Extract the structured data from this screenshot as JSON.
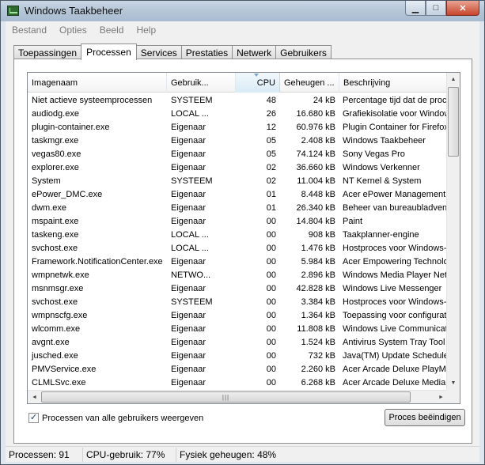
{
  "window": {
    "title": "Windows Taakbeheer"
  },
  "controls": {
    "minimize": "▁",
    "maximize": "□",
    "close": "✕"
  },
  "menu": [
    "Bestand",
    "Opties",
    "Beeld",
    "Help"
  ],
  "tabs": [
    {
      "label": "Toepassingen",
      "active": false
    },
    {
      "label": "Processen",
      "active": true
    },
    {
      "label": "Services",
      "active": false
    },
    {
      "label": "Prestaties",
      "active": false
    },
    {
      "label": "Netwerk",
      "active": false
    },
    {
      "label": "Gebruikers",
      "active": false
    }
  ],
  "columns": {
    "name": "Imagenaam",
    "user": "Gebruik...",
    "cpu": "CPU",
    "memory": "Geheugen ...",
    "description": "Beschrijving"
  },
  "rows": [
    {
      "name": "Niet actieve systeemprocessen",
      "user": "SYSTEEM",
      "cpu": "48",
      "mem": "24 kB",
      "desc": "Percentage tijd dat de processor niet actief is"
    },
    {
      "name": "audiodg.exe",
      "user": "LOCAL ...",
      "cpu": "26",
      "mem": "16.680 kB",
      "desc": "Grafiekisolatie voor Windows-audioapparaat"
    },
    {
      "name": "plugin-container.exe",
      "user": "Eigenaar",
      "cpu": "12",
      "mem": "60.976 kB",
      "desc": "Plugin Container for Firefox"
    },
    {
      "name": "taskmgr.exe",
      "user": "Eigenaar",
      "cpu": "05",
      "mem": "2.408 kB",
      "desc": "Windows Taakbeheer"
    },
    {
      "name": "vegas80.exe",
      "user": "Eigenaar",
      "cpu": "05",
      "mem": "74.124 kB",
      "desc": "Sony Vegas Pro"
    },
    {
      "name": "explorer.exe",
      "user": "Eigenaar",
      "cpu": "02",
      "mem": "36.660 kB",
      "desc": "Windows Verkenner"
    },
    {
      "name": "System",
      "user": "SYSTEEM",
      "cpu": "02",
      "mem": "11.004 kB",
      "desc": "NT Kernel & System"
    },
    {
      "name": "ePower_DMC.exe",
      "user": "Eigenaar",
      "cpu": "01",
      "mem": "8.448 kB",
      "desc": "Acer ePower Management - DMC"
    },
    {
      "name": "dwm.exe",
      "user": "Eigenaar",
      "cpu": "01",
      "mem": "26.340 kB",
      "desc": "Beheer van bureaubladvensters"
    },
    {
      "name": "mspaint.exe",
      "user": "Eigenaar",
      "cpu": "00",
      "mem": "14.804 kB",
      "desc": "Paint"
    },
    {
      "name": "taskeng.exe",
      "user": "LOCAL ...",
      "cpu": "00",
      "mem": "908 kB",
      "desc": "Taakplanner-engine"
    },
    {
      "name": "svchost.exe",
      "user": "LOCAL ...",
      "cpu": "00",
      "mem": "1.476 kB",
      "desc": "Hostproces voor Windows-services"
    },
    {
      "name": "Framework.NotificationCenter.exe",
      "user": "Eigenaar",
      "cpu": "00",
      "mem": "5.984 kB",
      "desc": "Acer Empowering Technology Framework"
    },
    {
      "name": "wmpnetwk.exe",
      "user": "NETWO...",
      "cpu": "00",
      "mem": "2.896 kB",
      "desc": "Windows Media Player Network Sharing"
    },
    {
      "name": "msnmsgr.exe",
      "user": "Eigenaar",
      "cpu": "00",
      "mem": "42.828 kB",
      "desc": "Windows Live Messenger"
    },
    {
      "name": "svchost.exe",
      "user": "SYSTEEM",
      "cpu": "00",
      "mem": "3.384 kB",
      "desc": "Hostproces voor Windows-services"
    },
    {
      "name": "wmpnscfg.exe",
      "user": "Eigenaar",
      "cpu": "00",
      "mem": "1.364 kB",
      "desc": "Toepassing voor configuratie van"
    },
    {
      "name": "wlcomm.exe",
      "user": "Eigenaar",
      "cpu": "00",
      "mem": "11.808 kB",
      "desc": "Windows Live Communications Platform"
    },
    {
      "name": "avgnt.exe",
      "user": "Eigenaar",
      "cpu": "00",
      "mem": "1.524 kB",
      "desc": "Antivirus System Tray Tool"
    },
    {
      "name": "jusched.exe",
      "user": "Eigenaar",
      "cpu": "00",
      "mem": "732 kB",
      "desc": "Java(TM) Update Scheduler"
    },
    {
      "name": "PMVService.exe",
      "user": "Eigenaar",
      "cpu": "00",
      "mem": "2.260 kB",
      "desc": "Acer Arcade Deluxe PlayMovie R"
    },
    {
      "name": "CLMLSvc.exe",
      "user": "Eigenaar",
      "cpu": "00",
      "mem": "6.268 kB",
      "desc": "Acer Arcade Deluxe MediaLibrary"
    }
  ],
  "show_all": {
    "label": "Processen van alle gebruikers weergeven",
    "checked": true,
    "mark": "✓"
  },
  "end_process": "Proces beëindigen",
  "scroll": {
    "up": "▲",
    "down": "▼",
    "left": "◄",
    "right": "►",
    "grip": "|||"
  },
  "status": {
    "processes": "Processen: 91",
    "cpu": "CPU-gebruik: 77%",
    "memory": "Fysiek geheugen: 48%"
  }
}
